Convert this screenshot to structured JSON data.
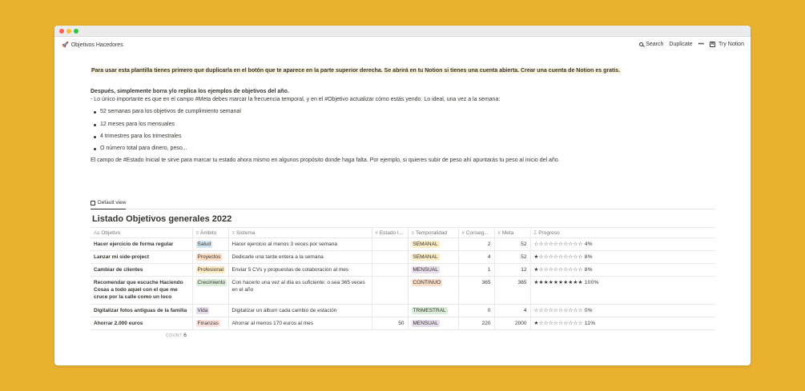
{
  "window": {
    "breadcrumb": "Objetivos Hacedores",
    "actions": {
      "search": "Search",
      "duplicate": "Duplicate",
      "more": "•••",
      "try": "Try Notion"
    }
  },
  "intro": "Para usar esta plantilla tienes primero que duplicarla en el botón que te aparece en la parte superior derecha. Se abrirá en tu Notion si tienes una cuenta abierta. Crear una cuenta de Notion es gratis.",
  "section": {
    "title": "Después, simplemente borra y/o replica los ejemplos de objetivos del año.",
    "line": "- Lo único importante es que en el campo #Meta debes marcar la frecuencia temporal, y en el #Objetivo actualizar cómo estás yendo. Lo ideal, una vez a la semana:",
    "bullets": [
      "52 semanas para los objetivos de cumplimiento semanal",
      "12 meses para los mensuales",
      "4 trimestres para los trimestrales",
      "O número total para dinero, peso..."
    ],
    "after": "El campo de #Estado Inicial te sirve para marcar tu estado ahora mismo en algunos propósito donde haga falta. Por ejemplo, si quieres subir de peso ahí apuntarás tu peso al inicio del año."
  },
  "database": {
    "view_label": "Default view",
    "title": "Listado Objetivos generales 2022",
    "columns": [
      {
        "icon": "Aa",
        "label": "Objetivo"
      },
      {
        "icon": "≡",
        "label": "Ámbito"
      },
      {
        "icon": "≡",
        "label": "Sistema"
      },
      {
        "icon": "#",
        "label": "Estado I..."
      },
      {
        "icon": "≡",
        "label": "Temporalidad"
      },
      {
        "icon": "#",
        "label": "Conseg..."
      },
      {
        "icon": "#",
        "label": "Meta"
      },
      {
        "icon": "Σ",
        "label": "Progreso"
      }
    ],
    "rows": [
      {
        "objetivo": "Hacer ejercicio de forma regular",
        "ambito": "Salud",
        "sistema": "Hacer ejercicio al menos 3 veces por semana",
        "estado": "",
        "temporalidad": "SEMANAL",
        "conseguido": "2",
        "meta": "52",
        "progreso": "☆☆☆☆☆☆☆☆☆☆ 4%"
      },
      {
        "objetivo": "Lanzar mi side-project",
        "ambito": "Proyectos",
        "sistema": "Dedicarle una tarde entera a la semana",
        "estado": "",
        "temporalidad": "SEMANAL",
        "conseguido": "4",
        "meta": "52",
        "progreso": "★☆☆☆☆☆☆☆☆☆ 8%"
      },
      {
        "objetivo": "Cambiar de clientes",
        "ambito": "Profesional",
        "sistema": "Enviar 5 CVs y propuestas de colaboración al mes",
        "estado": "",
        "temporalidad": "MENSUAL",
        "conseguido": "1",
        "meta": "12",
        "progreso": "★☆☆☆☆☆☆☆☆☆ 8%"
      },
      {
        "objetivo": "Recomendar que escuche Haciendo Cosas a todo aquel con el que me cruce por la calle como un loco",
        "ambito": "Crecimiento",
        "sistema": "Con hacerlo una vez al día es suficiente: o sea 365 veces en el año",
        "estado": "",
        "temporalidad": "CONTINUO",
        "conseguido": "365",
        "meta": "365",
        "progreso": "★★★★★★★★★★ 100%"
      },
      {
        "objetivo": "Digitalizar fotos antiguas de la familia",
        "ambito": "Vida",
        "sistema": "Digitalizar un álbum cada cambio de estación",
        "estado": "",
        "temporalidad": "TRIMESTRAL",
        "conseguido": "0",
        "meta": "4",
        "progreso": "☆☆☆☆☆☆☆☆☆☆ 0%"
      },
      {
        "objetivo": "Ahorrar 2.000 euros",
        "ambito": "Finanzas",
        "sistema": "Ahorrar al menos 170 euros al mes",
        "estado": "50",
        "temporalidad": "MENSUAL",
        "conseguido": "220",
        "meta": "2000",
        "progreso": "★☆☆☆☆☆☆☆☆☆ 11%"
      }
    ],
    "count_label": "COUNT",
    "count_value": "6"
  },
  "colors": {
    "background": "#e8b22f",
    "tags": {
      "Salud": "#d3e5ef",
      "Proyectos": "#fadec9",
      "Profesional": "#fdecc8",
      "Crecimiento": "#dbeddb",
      "Vida": "#e8deee",
      "Finanzas": "#ffe2dd",
      "SEMANAL": "#fdecc8",
      "MENSUAL": "#e8deee",
      "CONTINUO": "#fadec9",
      "TRIMESTRAL": "#dbeddb"
    }
  }
}
